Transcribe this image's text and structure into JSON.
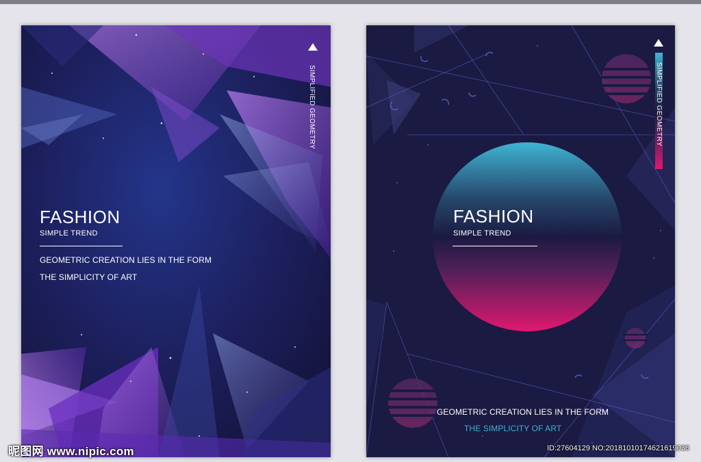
{
  "left_poster": {
    "title": "FASHION",
    "subtitle": "SIMPLE TREND",
    "line1": "GEOMETRIC CREATION LIES IN THE FORM",
    "line2": "THE SIMPLICITY OF ART",
    "vertical": "SIMPLIFIED GEOMETRY",
    "colors": {
      "background": "#1c1d4e",
      "accent": "#7a3bc8"
    }
  },
  "right_poster": {
    "title": "FASHION",
    "subtitle": "SIMPLE TREND",
    "line1": "GEOMETRIC CREATION LIES IN THE FORM",
    "line2": "THE SIMPLICITY OF ART",
    "vertical": "SIMPLIFIED GEOMETRY",
    "colors": {
      "background": "#1b1a42",
      "circle_top": "#3fb4d3",
      "circle_bottom": "#e0186f"
    }
  },
  "watermark": {
    "site": "昵图网 www.nipic.com",
    "id": "ID:27604129 NO:20181010174621619036"
  }
}
